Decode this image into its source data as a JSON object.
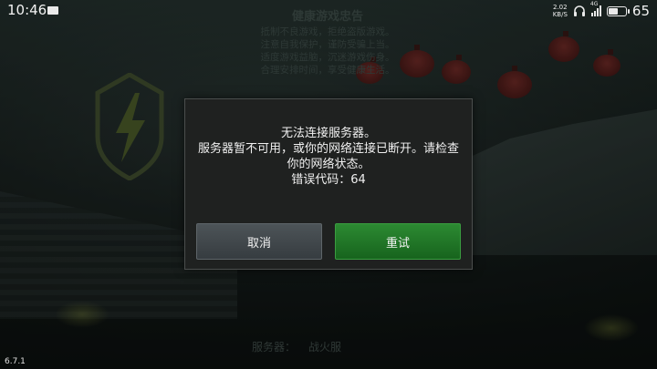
{
  "status_bar": {
    "time": "10:46",
    "net_speed_value": "2.02",
    "net_speed_unit": "KB/S",
    "network_type": "4G",
    "battery_level": "65",
    "battery_fraction": 0.65,
    "icons": [
      "notification-icon",
      "headset-icon",
      "signal-icon",
      "battery-icon"
    ]
  },
  "background": {
    "notice_title": "健康游戏忠告",
    "notice_lines": [
      "抵制不良游戏，拒绝盗版游戏。",
      "注意自我保护，谨防受骗上当。",
      "适度游戏益脑，沉迷游戏伤身。",
      "合理安排时间，享受健康生活。"
    ],
    "server_label": "服务器：",
    "server_name": "战火服"
  },
  "dialog": {
    "line1": "无法连接服务器。",
    "line2": "服务器暂不可用，或你的网络连接已断开。请检查",
    "line3": "你的网络状态。",
    "line4": "错误代码：64",
    "cancel_label": "取消",
    "retry_label": "重试"
  },
  "version": "6.7.1",
  "colors": {
    "retry_button": "#1f7a26",
    "cancel_button": "#444b4f",
    "dialog_bg": "#1f2120"
  }
}
